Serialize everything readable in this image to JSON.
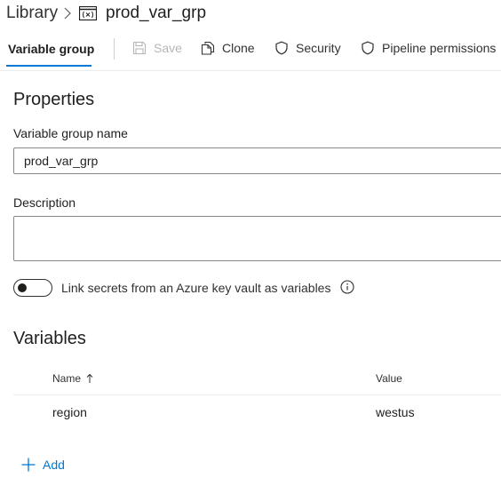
{
  "breadcrumb": {
    "root": "Library",
    "current": "prod_var_grp"
  },
  "toolbar": {
    "tab_label": "Variable group",
    "save_label": "Save",
    "clone_label": "Clone",
    "security_label": "Security",
    "pipeline_permissions_label": "Pipeline permissions"
  },
  "properties": {
    "heading": "Properties",
    "name_label": "Variable group name",
    "name_value": "prod_var_grp",
    "description_label": "Description",
    "description_value": "",
    "keyvault_toggle_label": "Link secrets from an Azure key vault as variables",
    "keyvault_toggle_on": false
  },
  "variables": {
    "heading": "Variables",
    "columns": {
      "name": "Name",
      "value": "Value"
    },
    "sort_indicator": "ascending",
    "rows": [
      {
        "name": "region",
        "value": "westus"
      }
    ],
    "add_label": "Add"
  },
  "colors": {
    "accent": "#0078d4",
    "text": "#201f1e",
    "disabled": "#b8b6b4",
    "border": "#8a8886"
  },
  "icons": {
    "breadcrumb_separator": "chevron-right-icon",
    "variable_group": "variable-group-icon",
    "save": "save-icon",
    "clone": "clone-icon",
    "security": "shield-icon",
    "pipeline_permissions": "shield-icon",
    "info": "info-icon",
    "sort": "arrow-up-icon",
    "add": "plus-icon"
  }
}
